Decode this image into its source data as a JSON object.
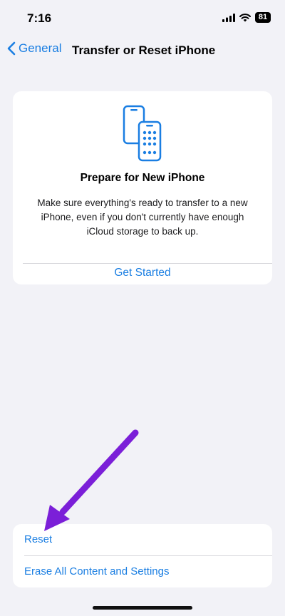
{
  "status_bar": {
    "time": "7:16",
    "battery_level": "81",
    "icons": [
      "signal-icon",
      "wifi-icon",
      "battery-icon"
    ]
  },
  "nav": {
    "back_label": "General",
    "title": "Transfer or Reset iPhone"
  },
  "prepare_card": {
    "icon": "phones-transfer-icon",
    "title": "Prepare for New iPhone",
    "description": "Make sure everything's ready to transfer to a new iPhone, even if you don't currently have enough iCloud storage to back up.",
    "action_label": "Get Started"
  },
  "reset_group": {
    "items": [
      {
        "label": "Reset"
      },
      {
        "label": "Erase All Content and Settings"
      }
    ]
  },
  "colors": {
    "accent": "#1a7ee2",
    "background": "#f2f2f7",
    "annotation_arrow": "#7b1fd8"
  }
}
